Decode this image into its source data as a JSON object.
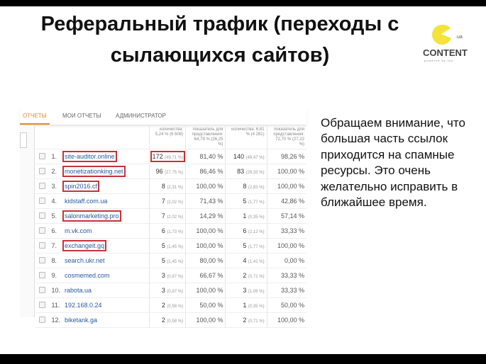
{
  "title": "Реферальный трафик (переходы с сылающихся сайтов)",
  "logo": {
    "text": "CONTENT",
    "suffix": ".ua",
    "tagline": "powered by fun",
    "color": "#f4e33a"
  },
  "note": "Обращаем внимание, что большая часть ссылок приходится на спамные ресурсы. Это очень желательно исправить в ближайшее время.",
  "screenshot": {
    "tabs": [
      "ОТЧЕТЫ",
      "МОИ ОТЧЕТЫ",
      "АДМИНИСТРАТОР"
    ],
    "headers": [
      "количества: 5,24 % (6 608)",
      "показатель для представления: 64,79 % (26,25 %)",
      "количества: 6,61 % (4 281)",
      "показатель для представления: 72,70 % (27,22 %)"
    ],
    "rows": [
      {
        "n": "1.",
        "domain": "site-auditor.online",
        "c1": "172",
        "p1": "(49,71 %)",
        "r1": "81,40 %",
        "c2": "140",
        "p2": "(49,47 %)",
        "r2": "98,26 %",
        "hl": true,
        "hlc": true
      },
      {
        "n": "2.",
        "domain": "monetizationking.net",
        "c1": "96",
        "p1": "(27,75 %)",
        "r1": "86,46 %",
        "c2": "83",
        "p2": "(29,33 %)",
        "r2": "100,00 %",
        "hl": true
      },
      {
        "n": "3.",
        "domain": "spin2016.cf",
        "c1": "8",
        "p1": "(2,31 %)",
        "r1": "100,00 %",
        "c2": "8",
        "p2": "(2,83 %)",
        "r2": "100,00 %",
        "hl": true
      },
      {
        "n": "4.",
        "domain": "kidstaff.com.ua",
        "c1": "7",
        "p1": "(2,02 %)",
        "r1": "71,43 %",
        "c2": "5",
        "p2": "(1,77 %)",
        "r2": "42,86 %"
      },
      {
        "n": "5.",
        "domain": "salonmarketing.pro",
        "c1": "7",
        "p1": "(2,02 %)",
        "r1": "14,29 %",
        "c2": "1",
        "p2": "(0,35 %)",
        "r2": "57,14 %",
        "hl": true
      },
      {
        "n": "6.",
        "domain": "m.vk.com",
        "c1": "6",
        "p1": "(1,73 %)",
        "r1": "100,00 %",
        "c2": "6",
        "p2": "(2,12 %)",
        "r2": "33,33 %"
      },
      {
        "n": "7.",
        "domain": "exchangeit.gq",
        "c1": "5",
        "p1": "(1,45 %)",
        "r1": "100,00 %",
        "c2": "5",
        "p2": "(1,77 %)",
        "r2": "100,00 %",
        "hl": true
      },
      {
        "n": "8.",
        "domain": "search.ukr.net",
        "c1": "5",
        "p1": "(1,45 %)",
        "r1": "80,00 %",
        "c2": "4",
        "p2": "(1,41 %)",
        "r2": "0,00 %"
      },
      {
        "n": "9.",
        "domain": "cosmemed.com",
        "c1": "3",
        "p1": "(0,87 %)",
        "r1": "66,67 %",
        "c2": "2",
        "p2": "(0,71 %)",
        "r2": "33,33 %"
      },
      {
        "n": "10.",
        "domain": "rabota.ua",
        "c1": "3",
        "p1": "(0,87 %)",
        "r1": "100,00 %",
        "c2": "3",
        "p2": "(1,06 %)",
        "r2": "33,33 %"
      },
      {
        "n": "11.",
        "domain": "192.168.0.24",
        "c1": "2",
        "p1": "(0,58 %)",
        "r1": "50,00 %",
        "c2": "1",
        "p2": "(0,35 %)",
        "r2": "50,00 %"
      },
      {
        "n": "12.",
        "domain": "biketank.ga",
        "c1": "2",
        "p1": "(0,58 %)",
        "r1": "100,00 %",
        "c2": "2",
        "p2": "(0,71 %)",
        "r2": "100,00 %"
      }
    ]
  },
  "colors": {
    "highlight": "#c8323a",
    "link": "#2a5aa0",
    "active_tab": "#e98a2c"
  }
}
